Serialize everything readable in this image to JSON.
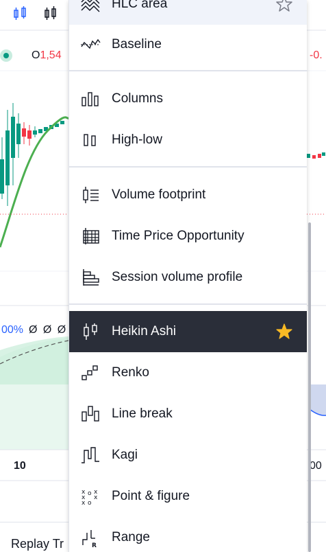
{
  "chart": {
    "open_label": "O",
    "open_value": "1,54",
    "right_value": "-0.",
    "indicator_pct": "00%",
    "indicator_values": "Ø Ø Ø",
    "axis_label_left": "10",
    "axis_label_right": "00",
    "replay_label": "Replay Tr"
  },
  "menu": {
    "items": [
      {
        "label": "HLC area",
        "icon": "hlc-area-icon",
        "favorite": false
      },
      {
        "label": "Baseline",
        "icon": "baseline-icon"
      },
      {
        "label": "Columns",
        "icon": "columns-icon"
      },
      {
        "label": "High-low",
        "icon": "high-low-icon"
      },
      {
        "label": "Volume footprint",
        "icon": "volume-footprint-icon"
      },
      {
        "label": "Time Price Opportunity",
        "icon": "time-price-opportunity-icon"
      },
      {
        "label": "Session volume profile",
        "icon": "session-volume-profile-icon"
      },
      {
        "label": "Heikin Ashi",
        "icon": "heikin-ashi-icon",
        "favorite": true,
        "selected": true
      },
      {
        "label": "Renko",
        "icon": "renko-icon"
      },
      {
        "label": "Line break",
        "icon": "line-break-icon"
      },
      {
        "label": "Kagi",
        "icon": "kagi-icon"
      },
      {
        "label": "Point & figure",
        "icon": "point-and-figure-icon"
      },
      {
        "label": "Range",
        "icon": "range-icon"
      }
    ]
  },
  "colors": {
    "up_candle": "#089981",
    "down_candle": "#f23645",
    "moving_average": "#4caf50",
    "selected_bg": "#2a2e39",
    "favorite_star": "#f7b924",
    "accent_blue": "#2962ff"
  }
}
